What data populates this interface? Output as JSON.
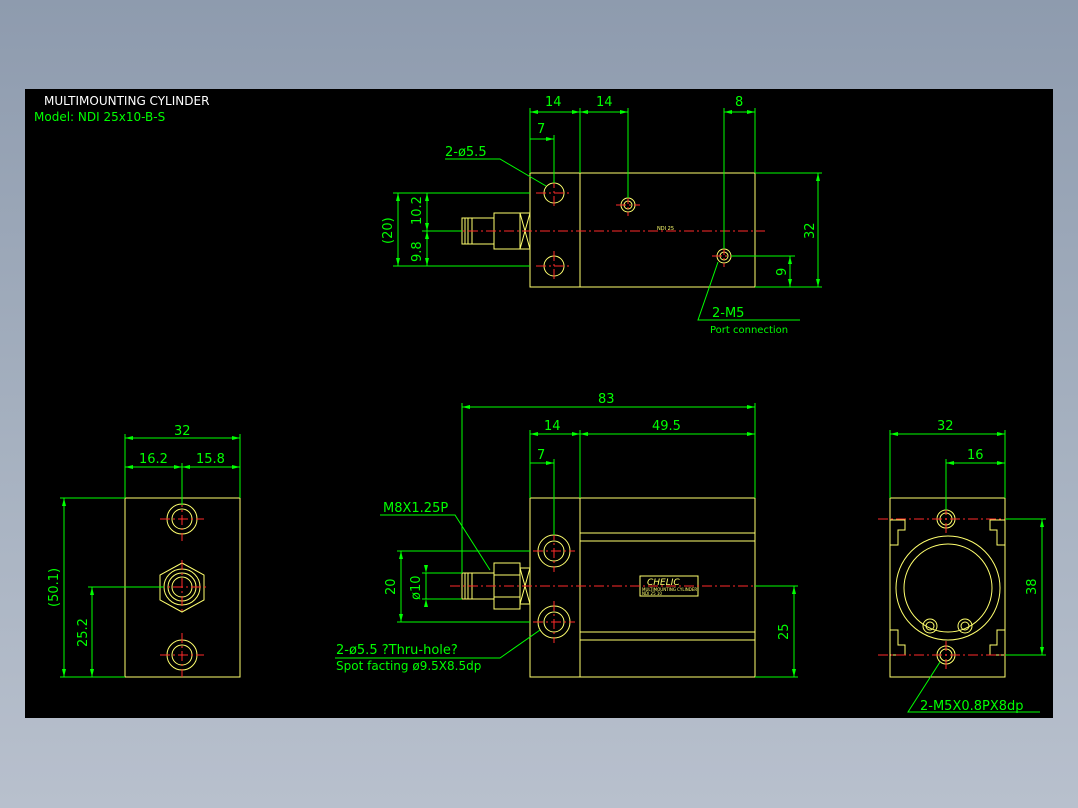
{
  "title_block": {
    "title": "MULTIMOUNTING CYLINDER",
    "model": "Model:  NDI 25x10-B-S"
  },
  "top_view": {
    "dim_14_a": "14",
    "dim_14_b": "14",
    "dim_8": "8",
    "dim_7": "7",
    "hole_callout": "2-ø5.5",
    "dim_20_ref": "(20)",
    "dim_10_2": "10.2",
    "dim_9_8": "9.8",
    "dim_32": "32",
    "dim_9": "9",
    "port_callout": "2-M5",
    "port_note": "Port connection",
    "body_mark": "NDI 25"
  },
  "left_view": {
    "dim_32": "32",
    "dim_16_2": "16.2",
    "dim_15_8": "15.8",
    "dim_50_1": "(50.1)",
    "dim_25_2": "25.2"
  },
  "front_view": {
    "dim_83": "83",
    "dim_14": "14",
    "dim_49_5": "49.5",
    "dim_7": "7",
    "thread_callout": "M8X1.25P",
    "dim_20": "20",
    "dim_dia10": "ø10",
    "dim_25": "25",
    "hole_callout": "2-ø5.5 ?Thru-hole?",
    "spot_facing": "Spot facting   ø9.5X8.5dp",
    "brand": "CHELIC",
    "brand_sub": "MULTIMOUNTING CYLINDER",
    "brand_model": "NDI 25 10"
  },
  "right_view": {
    "dim_32": "32",
    "dim_16": "16",
    "dim_38": "38",
    "tap_callout": "2-M5X0.8PX8dp"
  },
  "colors": {
    "canvas": "#000000",
    "outline": "#ffff6e",
    "dimension": "#00ff00",
    "centerline": "#ff2a2a",
    "text": "#ffffff"
  }
}
